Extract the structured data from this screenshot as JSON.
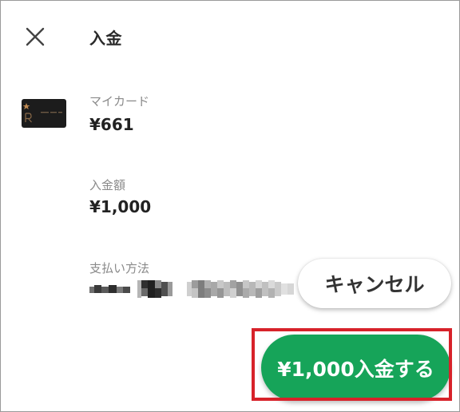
{
  "header": {
    "title": "入金",
    "close_icon": "close-icon"
  },
  "card": {
    "label": "マイカード",
    "balance": "¥661",
    "icon": "card-thumbnail"
  },
  "amount": {
    "label": "入金額",
    "value": "¥1,000"
  },
  "payment": {
    "label": "支払い方法"
  },
  "buttons": {
    "cancel_label": "キャンセル",
    "deposit_label": "¥1,000入金する"
  },
  "colors": {
    "primary_green": "#16a459",
    "highlight_red": "#d7222a"
  }
}
